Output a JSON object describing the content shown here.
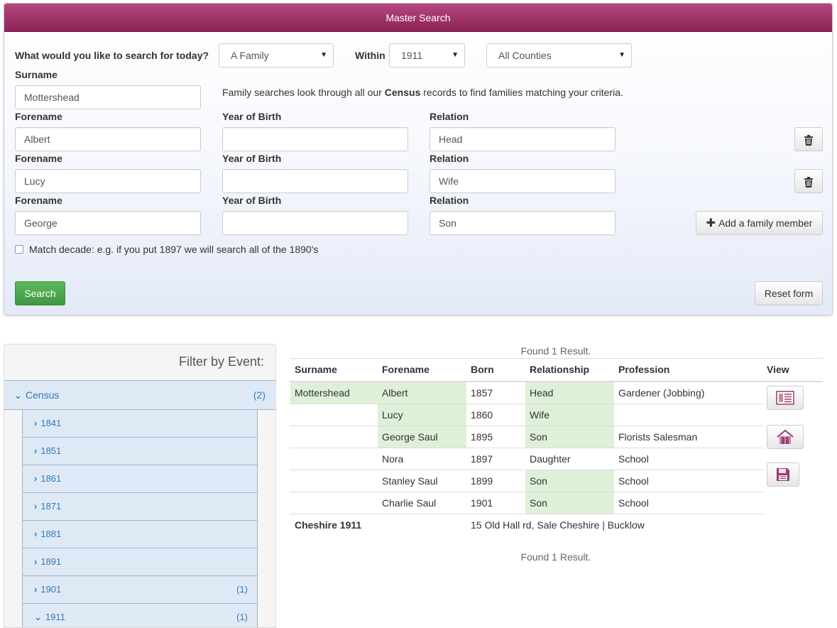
{
  "search": {
    "title": "Master Search",
    "question": "What would you like to search for today?",
    "type_value": "A Family",
    "within_label": "Within",
    "year_value": "1911",
    "county_value": "All Counties",
    "surname_label": "Surname",
    "surname_value": "Mottershead",
    "info_pre": "Family searches look through all our ",
    "info_bold": "Census",
    "info_post": " records to find families matching your criteria.",
    "forename_label": "Forename",
    "yob_label": "Year of Birth",
    "relation_label": "Relation",
    "members": [
      {
        "forename": "Albert",
        "yob": "",
        "relation": "Head"
      },
      {
        "forename": "Lucy",
        "yob": "",
        "relation": "Wife"
      },
      {
        "forename": "George",
        "yob": "",
        "relation": "Son"
      }
    ],
    "add_member_label": "Add a family member",
    "match_decade_label": "Match decade: e.g. if you put 1897 we will search all of the 1890's",
    "search_button": "Search",
    "reset_button": "Reset form"
  },
  "filter": {
    "title": "Filter by Event:",
    "census_label": "Census",
    "census_count": "(2)",
    "years": [
      {
        "label": "1841",
        "count": ""
      },
      {
        "label": "1851",
        "count": ""
      },
      {
        "label": "1861",
        "count": ""
      },
      {
        "label": "1871",
        "count": ""
      },
      {
        "label": "1881",
        "count": ""
      },
      {
        "label": "1891",
        "count": ""
      },
      {
        "label": "1901",
        "count": "(1)"
      },
      {
        "label": "1911",
        "count": "(1)"
      }
    ]
  },
  "results": {
    "found_text": "Found 1 Result.",
    "headers": [
      "Surname",
      "Forename",
      "Born",
      "Relationship",
      "Profession",
      "View"
    ],
    "rows": [
      {
        "surname": "Mottershead",
        "forename": "Albert",
        "born": "1857",
        "relationship": "Head",
        "profession": "Gardener (Jobbing)"
      },
      {
        "surname": "",
        "forename": "Lucy",
        "born": "1860",
        "relationship": "Wife",
        "profession": ""
      },
      {
        "surname": "",
        "forename": "George Saul",
        "born": "1895",
        "relationship": "Son",
        "profession": "Florists Salesman"
      },
      {
        "surname": "",
        "forename": "Nora",
        "born": "1897",
        "relationship": "Daughter",
        "profession": "School"
      },
      {
        "surname": "",
        "forename": "Stanley Saul",
        "born": "1899",
        "relationship": "Son",
        "profession": "School"
      },
      {
        "surname": "",
        "forename": "Charlie Saul",
        "born": "1901",
        "relationship": "Son",
        "profession": "School"
      }
    ],
    "footer_place": "Cheshire 1911",
    "footer_address": "15 Old Hall rd, Sale Cheshire | Bucklow"
  },
  "colors": {
    "header_gradient_top": "#b5477d",
    "header_gradient_bottom": "#8c2357",
    "match_green": "#dff0d8",
    "link_blue": "#337ab7",
    "success_green": "#5cb85c",
    "icon_maroon": "#9c3c6c"
  }
}
